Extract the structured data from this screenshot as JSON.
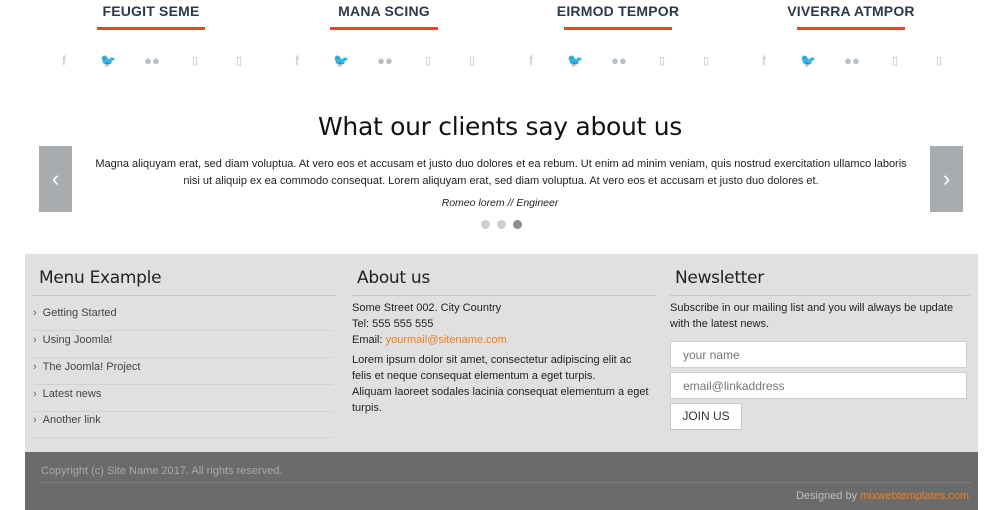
{
  "team": [
    {
      "name": "FEUGIT SEME"
    },
    {
      "name": "MANA SCING"
    },
    {
      "name": "EIRMOD TEMPOR"
    },
    {
      "name": "VIVERRA ATMPOR"
    }
  ],
  "social_icons": [
    "facebook-icon",
    "twitter-icon",
    "flickr-icon",
    "linkedin-icon",
    "pinterest-icon"
  ],
  "social_glyphs": [
    "f",
    "🐦",
    "●●",
    "▯",
    "▯"
  ],
  "testimonial": {
    "title": "What our clients say about us",
    "quote": "Magna aliquyam erat, sed diam voluptua. At vero eos et accusam et justo duo dolores et ea rebum. Ut enim ad minim veniam, quis nostrud exercitation ullamco laboris nisi ut aliquip ex ea commodo consequat. Lorem aliquyam erat, sed diam voluptua. At vero eos et accusam et justo duo dolores et.",
    "author": "Romeo lorem // Engineer",
    "prev_glyph": "‹",
    "next_glyph": "›",
    "active_slide": 3,
    "slide_count": 3
  },
  "menu": {
    "title": "Menu Example",
    "items": [
      "Getting Started",
      "Using Joomla!",
      "The Joomla! Project",
      "Latest news",
      "Another link"
    ]
  },
  "about": {
    "title": "About us",
    "address": "Some Street 002. City Country",
    "tel": "Tel: 555 555 555",
    "email_label": "Email: ",
    "email": "yourmail@sitename.com",
    "para1": "Lorem ipsum dolor sit amet, consectetur adipiscing elit ac felis et neque consequat elementum a eget turpis.",
    "para2": "Aliquam laoreet sodales lacinia consequat elementum a eget turpis."
  },
  "newsletter": {
    "title": "Newsletter",
    "description": "Subscribe in our mailing list and you will always be update with the latest news.",
    "name_placeholder": "your name",
    "email_placeholder": "email@linkaddress",
    "button_label": "JOIN US"
  },
  "footer": {
    "copyright": "Copyright (c) Site Name 2017. All rights reserved.",
    "designed_by_label": "Designed by ",
    "designed_by_link": "mixwebtemplates.com"
  },
  "colors": {
    "accent_red": "#e8452c",
    "link_orange": "#f07e1c",
    "footer_bg": "#e0e0e0",
    "footer_bottom_bg": "#6b6b6b"
  }
}
